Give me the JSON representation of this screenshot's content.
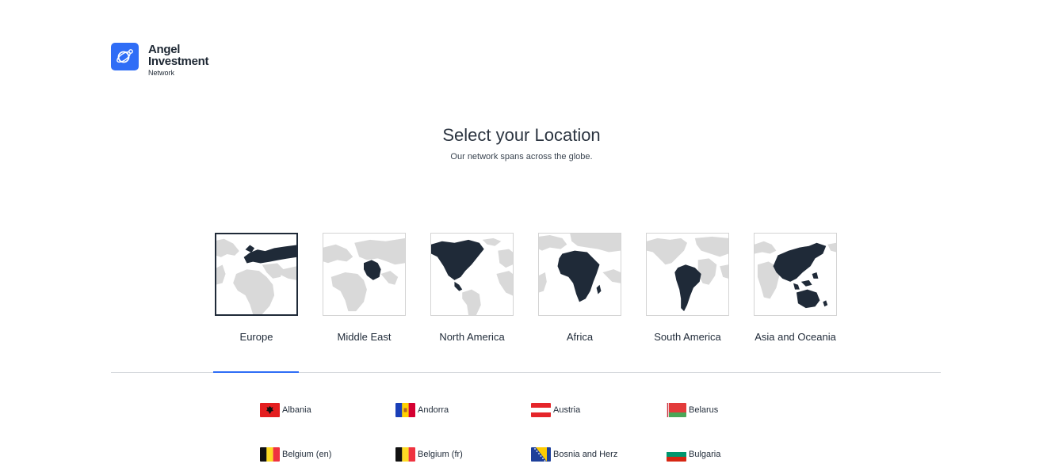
{
  "brand": {
    "line1": "Angel",
    "line2": "Investment",
    "line3": "Network",
    "color": "#2f6df6"
  },
  "header": {
    "title": "Select your Location",
    "subtitle": "Our network spans across the globe."
  },
  "regions": [
    {
      "label": "Europe",
      "selected": true
    },
    {
      "label": "Middle East",
      "selected": false
    },
    {
      "label": "North America",
      "selected": false
    },
    {
      "label": "Africa",
      "selected": false
    },
    {
      "label": "South America",
      "selected": false
    },
    {
      "label": "Asia and Oceania",
      "selected": false
    }
  ],
  "countries": [
    {
      "name": "Albania",
      "flag": "albania-flag"
    },
    {
      "name": "Andorra",
      "flag": "andorra-flag"
    },
    {
      "name": "Austria",
      "flag": "austria-flag"
    },
    {
      "name": "Belarus",
      "flag": "belarus-flag"
    },
    {
      "name": "Belgium (en)",
      "flag": "belgium-flag"
    },
    {
      "name": "Belgium (fr)",
      "flag": "belgium-flag"
    },
    {
      "name": "Bosnia and Herz",
      "flag": "bosnia-flag"
    },
    {
      "name": "Bulgaria",
      "flag": "bulgaria-flag"
    }
  ],
  "colors": {
    "land": "#d9d9d9",
    "highlight": "#1f2a38",
    "active_tab": "#2f6df6"
  }
}
